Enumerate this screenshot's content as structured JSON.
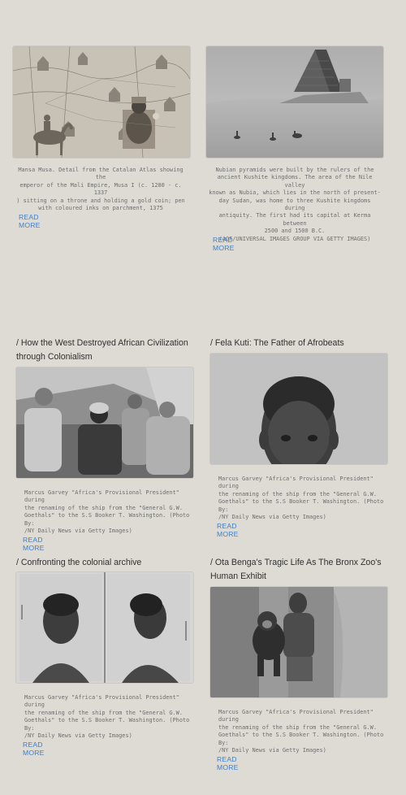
{
  "read_more_label": "READ MORE",
  "cards": [
    {
      "caption": "Mansa Musa. Detail from the Catalan Atlas showing the\nemperor of the Mali Empire, Musa I (c. 1280 - c. 1337\n) sitting on a throne and holding a gold coin; pen\nwith coloured inks on parchment, 1375"
    },
    {
      "caption": "Nubian pyramids were built by the rulers of the\nancient Kushite kingdoms. The area of the Nile valley\nknown as Nubia, which lies in the north of present-\nday Sudan, was home to three Kushite kingdoms during\nantiquity. The first had its capital at Kerma between\n2500 and 1500 B.C.\n(AGF/UNIVERSAL IMAGES GROUP VIA GETTY IMAGES)"
    },
    {
      "title": "/ How the West Destroyed African Civilization through Colonialism",
      "caption": "Marcus Garvey \"Africa's Provisional President\" during\nthe renaming of the ship from the \"General G.W.\nGoethals\" to the S.S Booker T. Washington. (Photo By:\n/NY Daily News via Getty Images)"
    },
    {
      "title": "/ Fela Kuti: The Father of Afrobeats",
      "caption": "Marcus Garvey \"Africa's Provisional President\" during\nthe renaming of the ship from the \"General G.W.\nGoethals\" to the S.S Booker T. Washington. (Photo By:\n/NY Daily News via Getty Images)"
    },
    {
      "title": "/ Confronting the colonial archive",
      "caption": "Marcus Garvey \"Africa's Provisional President\" during\nthe renaming of the ship from the \"General G.W.\nGoethals\" to the S.S Booker T. Washington. (Photo By:\n/NY Daily News via Getty Images)"
    },
    {
      "title": "/ Ota Benga's Tragic Life As The Bronx Zoo's Human Exhibit",
      "caption": "Marcus Garvey \"Africa's Provisional President\" during\nthe renaming of the ship from the \"General G.W.\nGoethals\" to the S.S Booker T. Washington. (Photo By:\n/NY Daily News via Getty Images)"
    }
  ],
  "colors": {
    "background": "#dedbd5",
    "link": "#3f7fc6",
    "caption": "#6e6e6e"
  }
}
